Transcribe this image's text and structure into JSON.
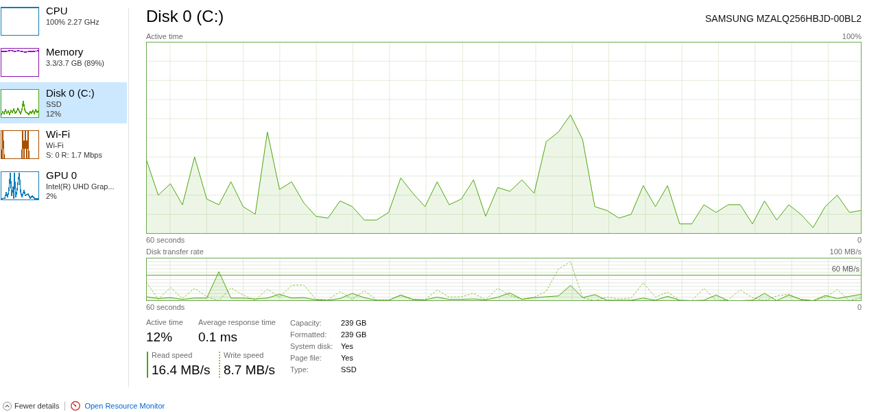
{
  "sidebar": {
    "items": [
      {
        "kind": "cpu",
        "title": "CPU",
        "details": [
          "100% 2.27 GHz"
        ],
        "color": "#117dbb",
        "selected": false
      },
      {
        "kind": "memory",
        "title": "Memory",
        "details": [
          "3.3/3.7 GB (89%)"
        ],
        "color": "#8b12ae",
        "selected": false
      },
      {
        "kind": "disk",
        "title": "Disk 0 (C:)",
        "details": [
          "SSD",
          "12%"
        ],
        "color": "#4da60c",
        "selected": true
      },
      {
        "kind": "network",
        "title": "Wi-Fi",
        "details": [
          "Wi-Fi",
          "S: 0 R: 1.7 Mbps"
        ],
        "color": "#a74f01",
        "selected": false
      },
      {
        "kind": "gpu",
        "title": "GPU 0",
        "details": [
          "Intel(R) UHD Grap...",
          "2%"
        ],
        "color": "#117dbb",
        "selected": false
      }
    ]
  },
  "header": {
    "title": "Disk 0 (C:)",
    "device_model": "SAMSUNG MZALQ256HBJD-00BL2"
  },
  "active_time_graph": {
    "title": "Active time",
    "scale_top_label": "100%",
    "time_span_label": "60 seconds",
    "scale_bottom_label": "0"
  },
  "transfer_rate_graph": {
    "title": "Disk transfer rate",
    "scale_top_label": "100 MB/s",
    "reference_label": "60 MB/s",
    "time_span_label": "60 seconds",
    "scale_bottom_label": "0"
  },
  "stats": {
    "metrics": [
      {
        "label": "Active time",
        "value": "12%"
      },
      {
        "label": "Average response time",
        "value": "0.1 ms"
      }
    ],
    "speeds": [
      {
        "kind": "solid",
        "color": "#4da60c",
        "label": "Read speed",
        "value": "16.4 MB/s"
      },
      {
        "kind": "dashed",
        "color": "#8cc63f",
        "label": "Write speed",
        "value": "8.7 MB/s"
      }
    ],
    "properties": [
      {
        "label": "Capacity:",
        "value": "239 GB"
      },
      {
        "label": "Formatted:",
        "value": "239 GB"
      },
      {
        "label": "System disk:",
        "value": "Yes"
      },
      {
        "label": "Page file:",
        "value": "Yes"
      },
      {
        "label": "Type:",
        "value": "SSD"
      }
    ]
  },
  "footer": {
    "fewer_details": "Fewer details",
    "resource_monitor_link": "Open Resource Monitor"
  }
}
